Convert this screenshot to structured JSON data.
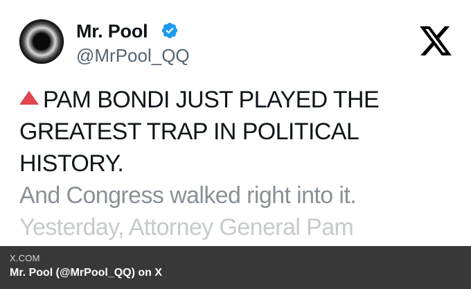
{
  "tweet": {
    "display_name": "Mr. Pool",
    "handle": "@MrPool_QQ",
    "verified_color": "#1d9bf0",
    "lines": [
      "PAM BONDI JUST PLAYED THE",
      "GREATEST TRAP IN POLITICAL",
      "HISTORY.",
      "And Congress walked right into it.",
      "Yesterday, Attorney General Pam"
    ],
    "bullet_icon": "red-triangle-up-icon",
    "bullet_color": "#e0464f"
  },
  "brand": {
    "logo_icon": "x-logo-icon"
  },
  "caption": {
    "domain": "X.COM",
    "title": "Mr. Pool (@MrPool_QQ) on X"
  }
}
